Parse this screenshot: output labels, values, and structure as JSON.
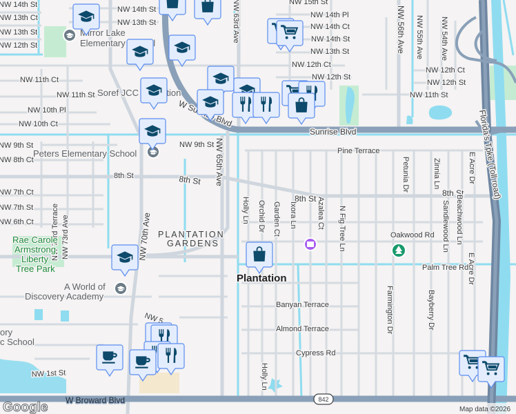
{
  "map": {
    "streets": [
      "NW 14th St",
      "NW 13th Ct",
      "NW 13th St",
      "NW 12th St",
      "NW 14th St",
      "NW 13th St",
      "NW 11th Ct",
      "NW 11th St",
      "NW 10th Pl",
      "NW 10th Ct",
      "NW 9th St",
      "NW 8th Ct",
      "NW 9th St",
      "8th St",
      "8th St",
      "NW 65th Ave",
      "NW 63rd Ave",
      "W Sunrise Blvd",
      "NW 15th St",
      "NW 14th Pl",
      "NW 14th Ct",
      "NW 14th St",
      "NW 13th St",
      "NW 12th Ct",
      "NW 12th St",
      "NW 56th Ave",
      "NW 55th Ave",
      "NW 54th Ave",
      "NW 12th Ct",
      "NW 12th St",
      "NW 11th St",
      "Sunrise Blvd",
      "Pine Terrace",
      "Petunia Dr",
      "Zinnia Ln",
      "E Acre Dr",
      "Florida's Tpke (Toll road)",
      "8th St",
      "8th St",
      "NW 7th Ct",
      "NW 7th St",
      "NW 6th Ct",
      "NW 73rd Terrace",
      "NW 73rd Ave",
      "Holly Ln",
      "Orchid Dr",
      "Garden Ct",
      "Ixora Ln",
      "Azalea Ct",
      "N Fig Tree Ln",
      "Sandlewood Ln",
      "Beachwood Ln",
      "Oakwood Rd",
      "Palm Tree Rd",
      "E Acre Dr",
      "NW 70th Ave",
      "NW 5",
      "NW 1st St",
      "W Broward Blvd",
      "Banyan Terrace",
      "Almond Terrace",
      "Cypress Rd",
      "Farmington Dr",
      "Bayberry Dr",
      "Holly Ln"
    ],
    "places": {
      "mirror_lake_1": "Mirror Lake",
      "mirror_lake_2": "Elementary School",
      "soref": "Soref JCC Plantation",
      "peters": "Peters Elementary School",
      "park_1": "Rae Carole",
      "park_2": "Armstrong",
      "park_3": "Liberty",
      "park_4": "Tree Park",
      "hood_1": "PLANTATION",
      "hood_2": "GARDENS",
      "city": "Plantation",
      "world_1": "A World of",
      "world_2": "Discovery Academy",
      "school_frag_1": "ory",
      "school_frag_2": "c School"
    },
    "route_shield": "842",
    "attribution": "Map data ©2026",
    "logo": "Google",
    "marker_types": [
      "education-icon",
      "shopping-bag-icon",
      "shopping-cart-icon",
      "restaurant-icon",
      "coffee-icon"
    ],
    "colors": {
      "marker_fill": "#e4edfd",
      "marker_border": "#5b8def",
      "marker_icon": "#0d4a6b",
      "canal": "#8fdcf0",
      "highway": "#8aa0b8",
      "park": "#c5ecd2"
    }
  }
}
